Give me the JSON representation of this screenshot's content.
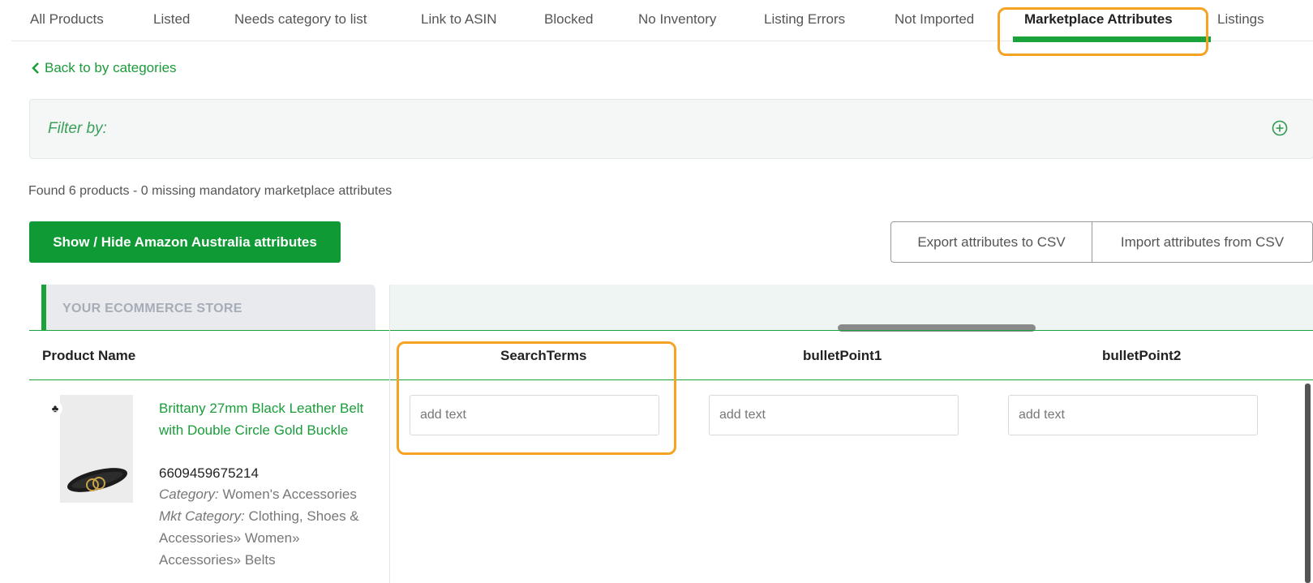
{
  "tabs": [
    {
      "label": "All Products"
    },
    {
      "label": "Listed"
    },
    {
      "label": "Needs category to list"
    },
    {
      "label": "Link to ASIN"
    },
    {
      "label": "Blocked"
    },
    {
      "label": "No Inventory"
    },
    {
      "label": "Listing Errors"
    },
    {
      "label": "Not Imported"
    },
    {
      "label": "Marketplace Attributes",
      "active": true
    },
    {
      "label": "Listings"
    }
  ],
  "back_link": {
    "label": "Back to by categories",
    "icon": "chevron-left-icon"
  },
  "filter": {
    "label": "Filter by:",
    "icon": "plus-circle-icon"
  },
  "summary": "Found 6 products - 0 missing mandatory marketplace attributes",
  "actions": {
    "toggle_label": "Show / Hide Amazon Australia attributes",
    "export_label": "Export attributes to CSV",
    "import_label": "Import attributes from CSV"
  },
  "store_band_label": "YOUR ECOMMERCE STORE",
  "table": {
    "columns": [
      "Product Name",
      "SearchTerms",
      "bulletPoint1",
      "bulletPoint2"
    ],
    "rows": [
      {
        "name": "Brittany 27mm Black Leather Belt with Double Circle Gold Buckle",
        "sku": "6609459675214",
        "category_key": "Category:",
        "category": "Women's Accessories",
        "mkt_category_key": "Mkt Category:",
        "mkt_category": "Clothing, Shoes & Accessories» Women» Accessories» Belts",
        "variant_icon": "variants-icon",
        "inputs": [
          {
            "value": "",
            "placeholder": "add text"
          },
          {
            "value": "",
            "placeholder": "add text"
          },
          {
            "value": "",
            "placeholder": "add text"
          }
        ]
      }
    ]
  },
  "colors": {
    "accent": "#1aa33b",
    "button": "#109a35",
    "highlight": "#f5a323",
    "link": "#1a9c3a"
  }
}
